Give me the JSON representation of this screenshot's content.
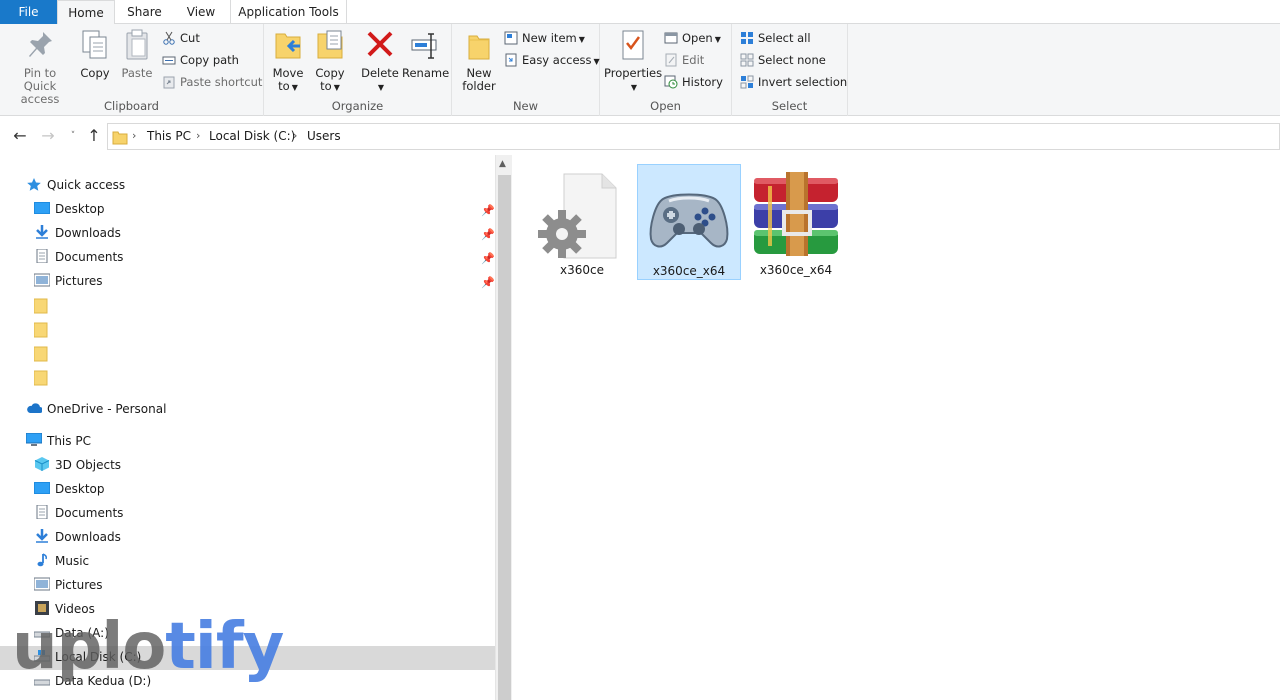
{
  "tabs": {
    "file": "File",
    "home": "Home",
    "share": "Share",
    "view": "View",
    "app_tools": "Application Tools"
  },
  "ribbon": {
    "clipboard": {
      "label": "Clipboard",
      "pin": "Pin to Quick access",
      "copy": "Copy",
      "paste": "Paste",
      "cut": "Cut",
      "copy_path": "Copy path",
      "paste_shortcut": "Paste shortcut"
    },
    "organize": {
      "label": "Organize",
      "move_to": "Move",
      "move_to_2": "to",
      "copy_to": "Copy",
      "copy_to_2": "to",
      "delete": "Delete",
      "rename": "Rename"
    },
    "new": {
      "label": "New",
      "new_folder": "New",
      "new_folder_2": "folder",
      "new_item": "New item",
      "easy_access": "Easy access"
    },
    "open": {
      "label": "Open",
      "properties": "Properties",
      "open": "Open",
      "edit": "Edit",
      "history": "History"
    },
    "select": {
      "label": "Select",
      "select_all": "Select all",
      "select_none": "Select none",
      "invert": "Invert selection"
    }
  },
  "address": {
    "crumbs": [
      "This PC",
      "Local Disk (C:)",
      "Users"
    ]
  },
  "nav": {
    "quick_access": "Quick access",
    "qa_items": [
      "Desktop",
      "Downloads",
      "Documents",
      "Pictures"
    ],
    "onedrive": "OneDrive - Personal",
    "this_pc": "This PC",
    "pc_items": [
      "3D Objects",
      "Desktop",
      "Documents",
      "Downloads",
      "Music",
      "Pictures",
      "Videos",
      "Data (A:)",
      "Local Disk (C:)",
      "Data Kedua (D:)"
    ]
  },
  "files": [
    {
      "name": "x360ce",
      "icon": "settings-file-icon",
      "selected": false
    },
    {
      "name": "x360ce_x64",
      "icon": "gamepad-icon",
      "selected": true
    },
    {
      "name": "x360ce_x64",
      "icon": "winrar-archive-icon",
      "selected": false
    }
  ],
  "watermark": {
    "left": "uplo",
    "accent": "tify"
  },
  "colors": {
    "accent": "#1979ca",
    "selection": "#cce8ff",
    "nav_selection": "#d9d9d9"
  }
}
